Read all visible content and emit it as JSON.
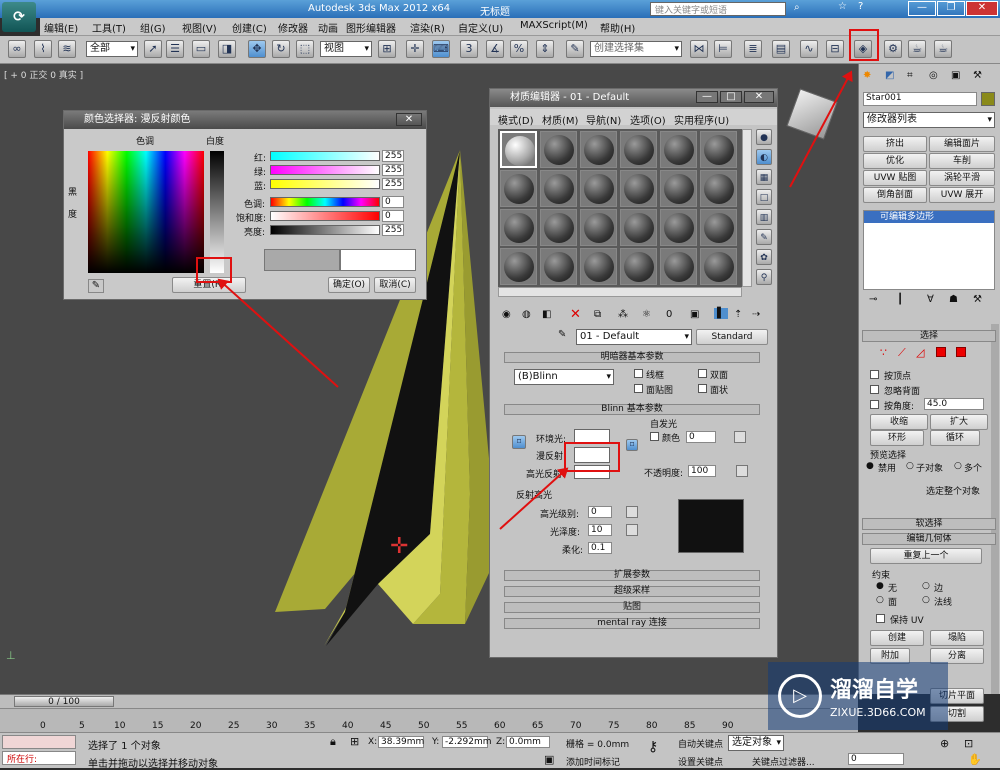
{
  "app": {
    "title": "Autodesk 3ds Max  2012 x64",
    "doc": "无标题",
    "search_placeholder": "键入关键字或短语"
  },
  "menu": [
    "编辑(E)",
    "工具(T)",
    "组(G)",
    "视图(V)",
    "创建(C)",
    "修改器",
    "动画",
    "图形编辑器",
    "渲染(R)",
    "自定义(U)",
    "MAXScript(M)",
    "帮助(H)"
  ],
  "toolbar": {
    "filter": "全部",
    "view": "视图",
    "selection_set": "创建选择集",
    "snap": "3"
  },
  "viewport": {
    "label": "[ + 0 正交 0 真实 ]"
  },
  "color_picker": {
    "title": "颜色选择器: 漫反射颜色",
    "hue_label": "色调",
    "white_label": "白度",
    "black_label": "黑",
    "degree_label": "度",
    "rows": [
      {
        "label": "红:",
        "value": "255"
      },
      {
        "label": "绿:",
        "value": "255"
      },
      {
        "label": "蓝:",
        "value": "255"
      },
      {
        "label": "色调:",
        "value": "0"
      },
      {
        "label": "饱和度:",
        "value": "0"
      },
      {
        "label": "亮度:",
        "value": "255"
      }
    ],
    "reset": "重置(R)",
    "ok": "确定(O)",
    "cancel": "取消(C)"
  },
  "material_editor": {
    "title": "材质编辑器 - 01 - Default",
    "menu": [
      "模式(D)",
      "材质(M)",
      "导航(N)",
      "选项(O)",
      "实用程序(U)"
    ],
    "material_name": "01 - Default",
    "material_type": "Standard",
    "shader_rollout": "明暗器基本参数",
    "shader": "(B)Blinn",
    "wire": "线框",
    "two_sided": "双面",
    "face_map": "面贴图",
    "faceted": "面状",
    "blinn_rollout": "Blinn 基本参数",
    "self_illum": "自发光",
    "ambient": "环境光:",
    "diffuse": "漫反射:",
    "specular": "高光反射:",
    "color": "颜色",
    "self_illum_value": "0",
    "opacity_label": "不透明度:",
    "opacity": "100",
    "spec_highlights": "反射高光",
    "spec_level_label": "高光级别:",
    "spec_level": "0",
    "glossiness_label": "光泽度:",
    "glossiness": "10",
    "soften_label": "柔化:",
    "soften": "0.1",
    "rollouts": [
      "扩展参数",
      "超级采样",
      "贴图",
      "mental ray 连接"
    ]
  },
  "command_panel": {
    "object_name": "Star001",
    "modifier_list": "修改器列表",
    "buttons": [
      "挤出",
      "编辑面片",
      "优化",
      "车削",
      "UVW 贴图",
      "涡轮平滑",
      "倒角剖面",
      "UVW 展开"
    ],
    "stack_item": "可编辑多边形",
    "select_title": "选择",
    "by_vertex": "按顶点",
    "ignore_back": "忽略背面",
    "by_angle": "按角度:",
    "angle": "45.0",
    "shrink": "收缩",
    "grow": "扩大",
    "ring": "环形",
    "loop": "循环",
    "preview": "预览选择",
    "disabled": "禁用",
    "sub_obj": "子对象",
    "multi": "多个",
    "whole_obj": "选定整个对象",
    "soft_sel": "软选择",
    "edit_geom": "编辑几何体",
    "repeat_last": "重复上一个",
    "constraints": "约束",
    "none": "无",
    "edge": "边",
    "face": "面",
    "normal": "法线",
    "preserve_uv": "保持 UV",
    "create": "创建",
    "collapse": "塌陷",
    "attach": "附加",
    "detach": "分离",
    "slice": "切片平面",
    "cut": "切割"
  },
  "timeline": {
    "frame": "0 / 100",
    "ticks": [
      "0",
      "5",
      "10",
      "15",
      "20",
      "25",
      "30",
      "35",
      "40",
      "45",
      "50",
      "55",
      "60",
      "65",
      "70",
      "75",
      "80",
      "85",
      "90"
    ]
  },
  "status": {
    "selected": "选择了 1 个对象",
    "hint": "单击并拖动以选择并移动对象",
    "x_label": "X:",
    "x": "38.39mm",
    "y_label": "Y:",
    "y": "-2.292mm",
    "z_label": "Z:",
    "z": "0.0mm",
    "grid": "栅格 = 0.0mm",
    "autokey": "自动关键点",
    "selected_obj": "选定对象",
    "setkey": "设置关键点",
    "key_filter": "关键点过滤器...",
    "add_time_tag": "添加时间标记",
    "in_progress": "所在行:",
    "frame_num": "0"
  },
  "watermark": {
    "brand": "溜溜自学",
    "url": "ZIXUE.3D66.COM"
  }
}
